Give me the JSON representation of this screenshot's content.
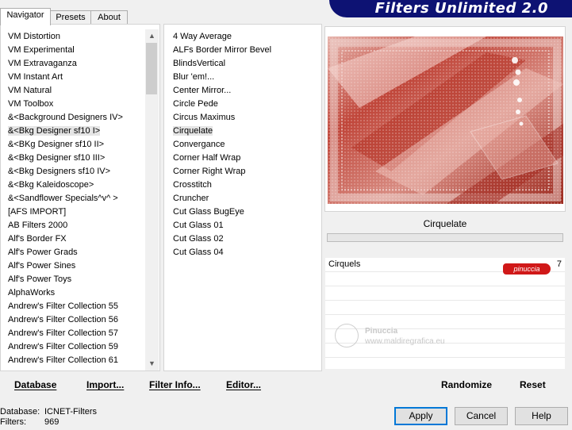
{
  "banner": {
    "title": "Filters Unlimited 2.0"
  },
  "tabs": [
    {
      "label": "Navigator",
      "active": true
    },
    {
      "label": "Presets",
      "active": false
    },
    {
      "label": "About",
      "active": false
    }
  ],
  "categories": [
    "VM Distortion",
    "VM Experimental",
    "VM Extravaganza",
    "VM Instant Art",
    "VM Natural",
    "VM Toolbox",
    "&<Background Designers IV>",
    "&<Bkg Designer sf10 I>",
    "&<BKg Designer sf10 II>",
    "&<Bkg Designer sf10 III>",
    "&<Bkg Designers sf10 IV>",
    "&<Bkg Kaleidoscope>",
    "&<Sandflower Specials^v^ >",
    "[AFS IMPORT]",
    "AB Filters 2000",
    "Alf's Border FX",
    "Alf's Power Grads",
    "Alf's Power Sines",
    "Alf's Power Toys",
    "AlphaWorks",
    "Andrew's Filter Collection 55",
    "Andrew's Filter Collection 56",
    "Andrew's Filter Collection 57",
    "Andrew's Filter Collection 59",
    "Andrew's Filter Collection 61"
  ],
  "selected_category": "&<Bkg Designer sf10 I>",
  "filters": [
    "4 Way Average",
    "ALFs Border Mirror Bevel",
    "BlindsVertical",
    "Blur 'em!...",
    "Center Mirror...",
    "Circle Pede",
    "Circus Maximus",
    "Cirquelate",
    "Convergance",
    "Corner Half Wrap",
    "Corner Right Wrap",
    "Crosstitch",
    "Cruncher",
    "Cut Glass  BugEye",
    "Cut Glass 01",
    "Cut Glass 02",
    "Cut Glass 04"
  ],
  "selected_filter": "Cirquelate",
  "preview": {
    "filter_name": "Cirquelate",
    "progress_percent": 0,
    "colors": {
      "base": "#c35446",
      "light": "#f2dcd8",
      "dark": "#8a2418"
    }
  },
  "params": [
    {
      "label": "Cirquels",
      "value": "7"
    }
  ],
  "watermark": {
    "badge": "pinuccia",
    "name": "Pinuccia",
    "site": "www.maldiregrafica.eu"
  },
  "toolbar": {
    "database": "Database",
    "import": "Import...",
    "filter_info": "Filter Info...",
    "editor": "Editor...",
    "randomize": "Randomize",
    "reset": "Reset"
  },
  "info": {
    "database_label": "Database:",
    "database_value": "ICNET-Filters",
    "filters_label": "Filters:",
    "filters_value": "969"
  },
  "buttons": {
    "apply": "Apply",
    "cancel": "Cancel",
    "help": "Help"
  }
}
